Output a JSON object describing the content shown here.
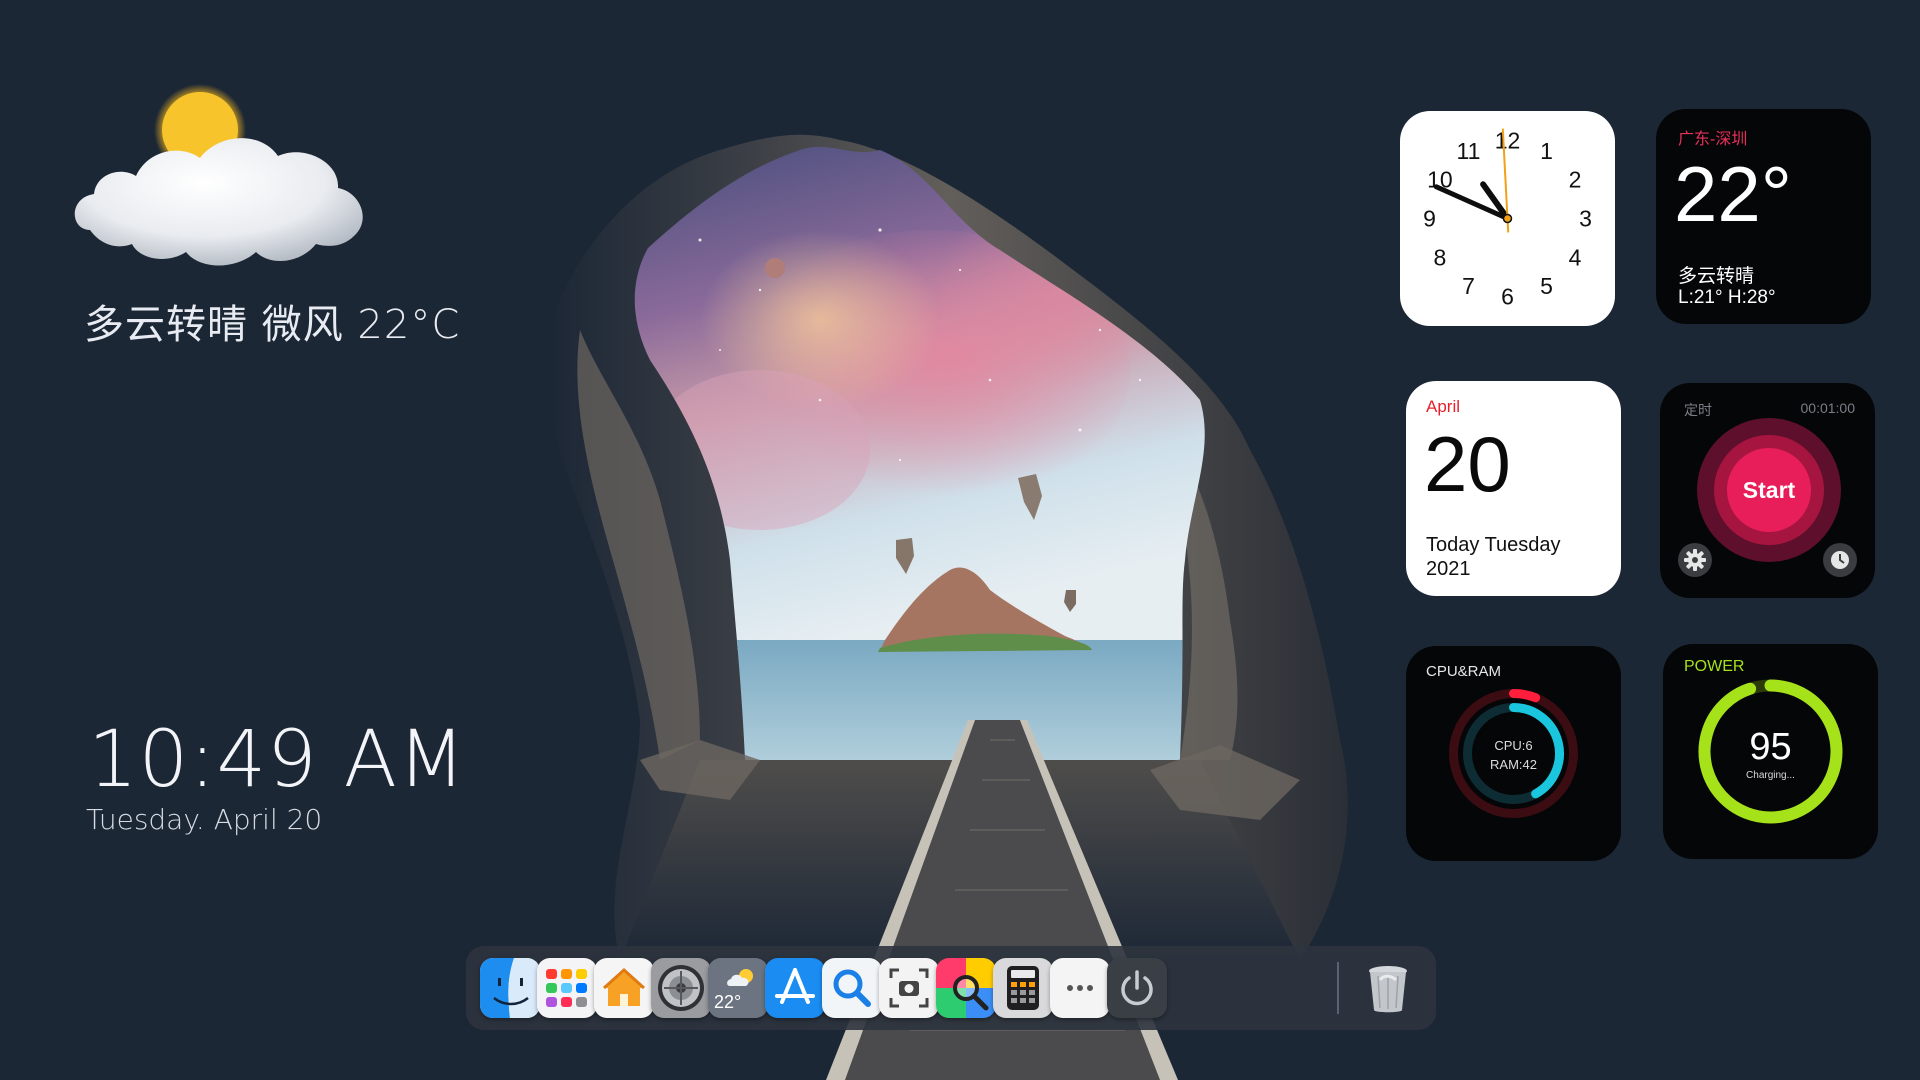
{
  "desktop": {
    "weather_line": "多云转晴 微风 22°C",
    "time": "10:49 AM",
    "date": "Tuesday.  April  20"
  },
  "clock_widget": {
    "numbers": [
      "12",
      "1",
      "2",
      "3",
      "4",
      "5",
      "6",
      "7",
      "8",
      "9",
      "10",
      "11"
    ],
    "time_shown": "10:49"
  },
  "weather_widget": {
    "city": "广东-深圳",
    "temp": "22°",
    "condition": "多云转晴",
    "range": "L:21° H:28°"
  },
  "calendar_widget": {
    "month": "April",
    "day": "20",
    "line1": "Today Tuesday",
    "line2": "2021"
  },
  "timer_widget": {
    "label": "定时",
    "duration": "00:01:00",
    "start_label": "Start"
  },
  "cpu_widget": {
    "label": "CPU&RAM",
    "cpu": "CPU:6",
    "ram": "RAM:42",
    "cpu_value": 6,
    "ram_value": 42
  },
  "power_widget": {
    "label": "POWER",
    "value": "95",
    "status": "Charging...",
    "level": 95
  },
  "dock": {
    "weather_temp": "22°",
    "items": [
      "finder-icon",
      "launchpad-icon",
      "home-icon",
      "settings-icon",
      "weather-icon",
      "app-store-icon",
      "search-icon",
      "screenshot-icon",
      "color-picker-icon",
      "calculator-icon",
      "more-icon",
      "power-icon",
      "trash-icon"
    ]
  },
  "colors": {
    "background": "#1c2736",
    "calendar_accent": "#e8202c",
    "timer_accent": "#e81e5b",
    "cpu_ring": "#19c6dd",
    "ram_ring": "#ff1f3d",
    "power_ring": "#a6e21a"
  }
}
